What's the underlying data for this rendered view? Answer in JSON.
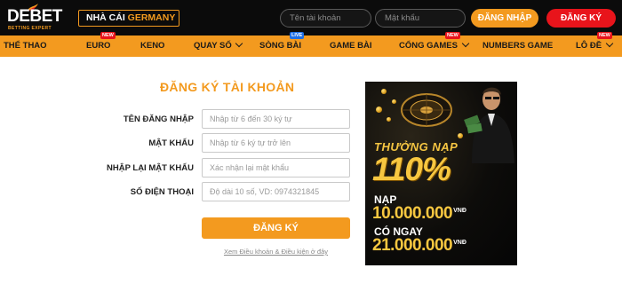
{
  "brand": {
    "logo_text": "DEBET",
    "logo_tagline": "BETTING EXPERT",
    "partner_prefix": "NHÀ CÁI",
    "partner_name": "GERMANY"
  },
  "header": {
    "username_placeholder": "Tên tài khoản",
    "password_placeholder": "Mật khẩu",
    "login_label": "ĐĂNG NHẬP",
    "register_label": "ĐĂNG KÝ"
  },
  "nav": {
    "items": [
      {
        "label": "THỂ THAO",
        "badge": "",
        "dropdown": false
      },
      {
        "label": "EURO",
        "badge": "NEW",
        "dropdown": false
      },
      {
        "label": "KENO",
        "badge": "",
        "dropdown": false
      },
      {
        "label": "QUAY SỐ",
        "badge": "",
        "dropdown": true
      },
      {
        "label": "SÒNG BÀI",
        "badge": "LIVE",
        "dropdown": false
      },
      {
        "label": "GAME BÀI",
        "badge": "",
        "dropdown": false
      },
      {
        "label": "CỔNG GAMES",
        "badge": "NEW",
        "dropdown": true
      },
      {
        "label": "NUMBERS GAME",
        "badge": "",
        "dropdown": false
      },
      {
        "label": "LÔ ĐỀ",
        "badge": "NEW",
        "dropdown": true
      }
    ]
  },
  "form": {
    "title": "ĐĂNG KÝ TÀI KHOẢN",
    "fields": [
      {
        "label": "TÊN ĐĂNG NHẬP",
        "placeholder": "Nhập từ 6 đến 30 ký tự"
      },
      {
        "label": "MẬT KHẨU",
        "placeholder": "Nhập từ 6 ký tự trở lên"
      },
      {
        "label": "NHẬP LẠI MẬT KHẨU",
        "placeholder": "Xác nhận lại mật khẩu"
      },
      {
        "label": "SỐ ĐIỆN THOẠI",
        "placeholder": "Độ dài 10 số, VD: 0974321845"
      }
    ],
    "submit_label": "ĐĂNG KÝ",
    "terms_link": "Xem Điều khoản & Điều kiện ở đây"
  },
  "banner": {
    "headline": "THƯỞNG NẠP",
    "percent": "110%",
    "deposit_label": "NẠP",
    "deposit_amount": "10.000.000",
    "bonus_label": "CÓ NGAY",
    "bonus_amount": "21.000.000",
    "currency": "VNĐ"
  },
  "colors": {
    "accent": "#f39a1f",
    "danger": "#e8141b",
    "topbar": "#0b0b0b"
  }
}
